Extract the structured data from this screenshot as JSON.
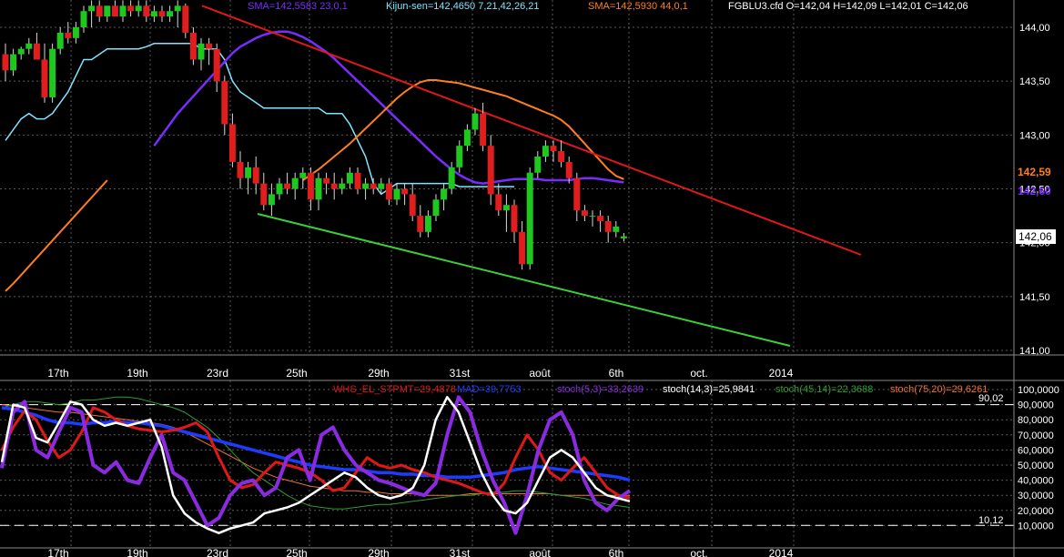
{
  "colors": {
    "background": "#000000",
    "grid": "#5a5a5a",
    "axis_text": "#ffffff",
    "bull_candle": "#1ec81e",
    "bear_candle": "#e01e1e",
    "wick": "#d9d9d9",
    "kijun": "#7fe5ff",
    "sma_purple": "#7a2cff",
    "sma_orange": "#ff7f1e",
    "resistance": "#e01818",
    "support": "#3ad03a",
    "whs": "#e01818",
    "stoch_blue": "#1e3cff",
    "stoch_white": "#ffffff",
    "stoch_green": "#2f9e2f",
    "stoch_orange": "#f0703a",
    "stoch_purple": "#8a2be2"
  },
  "header": {
    "sma1": "SMA=142,5583  23,0,1",
    "kijun": "Kijun-sen=142,4650  7,21,42,26,21",
    "sma2": "SMA=142,5930  44,0,1",
    "ohlc": "FGBLU3.cfd O=142,04 H=142,09 L=142,01 C=142,06"
  },
  "price_badges": {
    "sma_orange": "142,59",
    "sma_purple": "142,60",
    "last": "142,06"
  },
  "x_labels": [
    "17th",
    "19th",
    "23rd",
    "25th",
    "29th",
    "31st",
    "août",
    "6th",
    "oct.",
    "2014"
  ],
  "y_labels_price": [
    "144,00",
    "143,50",
    "143,00",
    "142,50",
    "142,00",
    "141,50",
    "141,00"
  ],
  "osc_header": {
    "whs": "WHS_EL_STPMT=29,4878",
    "mad": "MAD=39,7753",
    "s1": "stoch(5,3)=33,2639",
    "s2": "stoch(14,3)=25,9841",
    "s3": "stoch(45,14)=22,3688",
    "s4": "stoch(75,20)=29,6261"
  },
  "osc_levels": {
    "upper": "90,02",
    "lower": "10,12"
  },
  "y_labels_osc": [
    "100,0000",
    "90,0000",
    "80,0000",
    "70,0000",
    "60,0000",
    "50,0000",
    "40,0000",
    "30,0000",
    "20,0000",
    "10,0000"
  ],
  "chart_data": {
    "type": "candlestick",
    "symbol": "FGBLU3.cfd",
    "price_ylim": [
      141.0,
      144.2
    ],
    "candles": [
      [
        143.75,
        143.85,
        143.5,
        143.6
      ],
      [
        143.6,
        143.8,
        143.55,
        143.75
      ],
      [
        143.75,
        143.82,
        143.7,
        143.8
      ],
      [
        143.8,
        143.9,
        143.75,
        143.85
      ],
      [
        143.85,
        143.95,
        143.75,
        143.7
      ],
      [
        143.7,
        143.85,
        143.3,
        143.35
      ],
      [
        143.35,
        143.85,
        143.3,
        143.8
      ],
      [
        143.8,
        144.0,
        143.75,
        143.95
      ],
      [
        143.95,
        144.05,
        143.85,
        143.9
      ],
      [
        143.9,
        144.05,
        143.85,
        144.0
      ],
      [
        144.0,
        144.2,
        143.95,
        144.15
      ],
      [
        144.15,
        144.25,
        144.0,
        144.2
      ],
      [
        144.2,
        144.25,
        144.05,
        144.1
      ],
      [
        144.1,
        144.2,
        144.05,
        144.2
      ],
      [
        144.2,
        144.25,
        144.1,
        144.1
      ],
      [
        144.1,
        144.25,
        144.05,
        144.2
      ],
      [
        144.2,
        144.25,
        144.1,
        144.15
      ],
      [
        144.15,
        144.25,
        144.1,
        144.2
      ],
      [
        144.2,
        144.25,
        144.05,
        144.1
      ],
      [
        144.1,
        144.2,
        144.05,
        144.15
      ],
      [
        144.15,
        144.2,
        144.05,
        144.1
      ],
      [
        144.1,
        144.2,
        144.05,
        144.15
      ],
      [
        144.15,
        144.25,
        144.0,
        144.2
      ],
      [
        144.2,
        144.22,
        143.9,
        143.95
      ],
      [
        143.95,
        144.0,
        143.65,
        143.7
      ],
      [
        143.7,
        143.9,
        143.6,
        143.85
      ],
      [
        143.85,
        143.9,
        143.65,
        143.8
      ],
      [
        143.8,
        143.85,
        143.4,
        143.5
      ],
      [
        143.5,
        143.55,
        143.0,
        143.1
      ],
      [
        143.1,
        143.2,
        142.7,
        142.75
      ],
      [
        142.75,
        142.85,
        142.5,
        142.6
      ],
      [
        142.6,
        142.75,
        142.45,
        142.7
      ],
      [
        142.7,
        142.8,
        142.45,
        142.55
      ],
      [
        142.55,
        142.65,
        142.3,
        142.35
      ],
      [
        142.35,
        142.55,
        142.25,
        142.45
      ],
      [
        142.45,
        142.6,
        142.4,
        142.55
      ],
      [
        142.55,
        142.65,
        142.45,
        142.5
      ],
      [
        142.5,
        142.65,
        142.4,
        142.6
      ],
      [
        142.6,
        142.7,
        142.5,
        142.65
      ],
      [
        142.65,
        142.7,
        142.3,
        142.4
      ],
      [
        142.4,
        142.65,
        142.3,
        142.6
      ],
      [
        142.6,
        142.65,
        142.45,
        142.55
      ],
      [
        142.55,
        142.65,
        142.4,
        142.5
      ],
      [
        142.5,
        142.6,
        142.45,
        142.55
      ],
      [
        142.55,
        142.7,
        142.5,
        142.65
      ],
      [
        142.65,
        142.7,
        142.45,
        142.5
      ],
      [
        142.5,
        142.6,
        142.4,
        142.55
      ],
      [
        142.55,
        142.6,
        142.45,
        142.5
      ],
      [
        142.5,
        142.6,
        142.45,
        142.55
      ],
      [
        142.55,
        142.6,
        142.35,
        142.4
      ],
      [
        142.4,
        142.55,
        142.35,
        142.5
      ],
      [
        142.5,
        142.55,
        142.35,
        142.45
      ],
      [
        142.45,
        142.55,
        142.2,
        142.25
      ],
      [
        142.25,
        142.35,
        142.05,
        142.1
      ],
      [
        142.1,
        142.3,
        142.05,
        142.25
      ],
      [
        142.25,
        142.45,
        142.2,
        142.4
      ],
      [
        142.4,
        142.55,
        142.3,
        142.5
      ],
      [
        142.5,
        142.75,
        142.45,
        142.7
      ],
      [
        142.7,
        142.95,
        142.65,
        142.9
      ],
      [
        142.9,
        143.1,
        142.85,
        143.05
      ],
      [
        143.05,
        143.25,
        143.0,
        143.2
      ],
      [
        143.2,
        143.3,
        142.85,
        142.9
      ],
      [
        142.9,
        143.0,
        142.35,
        142.45
      ],
      [
        142.45,
        142.55,
        142.25,
        142.3
      ],
      [
        142.3,
        142.45,
        142.1,
        142.35
      ],
      [
        142.35,
        142.4,
        142.0,
        142.1
      ],
      [
        142.1,
        142.2,
        141.75,
        141.8
      ],
      [
        141.8,
        142.7,
        141.75,
        142.65
      ],
      [
        142.65,
        142.85,
        142.6,
        142.8
      ],
      [
        142.8,
        142.95,
        142.75,
        142.9
      ],
      [
        142.9,
        142.95,
        142.75,
        142.85
      ],
      [
        142.85,
        142.95,
        142.7,
        142.75
      ],
      [
        142.75,
        142.8,
        142.55,
        142.6
      ],
      [
        142.6,
        142.65,
        142.2,
        142.3
      ],
      [
        142.3,
        142.35,
        142.2,
        142.25
      ],
      [
        142.25,
        142.3,
        142.15,
        142.25
      ],
      [
        142.25,
        142.3,
        142.1,
        142.2
      ],
      [
        142.2,
        142.25,
        142.0,
        142.1
      ],
      [
        142.1,
        142.2,
        142.05,
        142.15
      ],
      [
        142.04,
        142.09,
        142.01,
        142.06
      ]
    ],
    "kijun_sen": [
      142.95,
      143.05,
      143.15,
      143.2,
      143.15,
      143.15,
      143.2,
      143.3,
      143.4,
      143.55,
      143.7,
      143.7,
      143.75,
      143.8,
      143.8,
      143.8,
      143.8,
      143.8,
      143.82,
      143.85,
      143.85,
      143.85,
      143.85,
      143.85,
      143.85,
      143.8,
      143.8,
      143.8,
      143.7,
      143.5,
      143.4,
      143.35,
      143.3,
      143.25,
      143.25,
      143.25,
      143.25,
      143.25,
      143.25,
      143.25,
      143.25,
      143.2,
      143.2,
      143.2,
      143.1,
      142.95,
      142.8,
      142.55,
      142.45,
      142.5,
      142.55,
      142.55,
      142.55,
      142.55,
      142.55,
      142.55,
      142.55,
      142.55,
      142.52,
      142.52,
      142.52,
      142.52,
      142.52,
      142.52,
      142.52,
      142.52
    ],
    "sma_23": [
      142.9,
      143.0,
      143.1,
      143.2,
      143.28,
      143.36,
      143.44,
      143.52,
      143.6,
      143.68,
      143.76,
      143.82,
      143.86,
      143.9,
      143.93,
      143.95,
      143.96,
      143.96,
      143.94,
      143.91,
      143.87,
      143.82,
      143.77,
      143.71,
      143.64,
      143.57,
      143.5,
      143.43,
      143.36,
      143.29,
      143.22,
      143.15,
      143.08,
      143.01,
      142.94,
      142.87,
      142.8,
      142.74,
      142.68,
      142.63,
      142.59,
      142.56,
      142.55,
      142.56,
      142.57,
      142.58,
      142.59,
      142.59,
      142.59,
      142.59,
      142.58,
      142.58,
      142.58,
      142.58,
      142.59,
      142.6,
      142.6,
      142.59,
      142.58,
      142.57,
      142.56
    ],
    "sma_44": [
      142.58,
      142.63,
      142.68,
      142.74,
      142.8,
      142.86,
      142.92,
      142.99,
      143.06,
      143.13,
      143.2,
      143.27,
      143.34,
      143.4,
      143.45,
      143.49,
      143.51,
      143.51,
      143.5,
      143.49,
      143.48,
      143.46,
      143.44,
      143.42,
      143.4,
      143.38,
      143.36,
      143.33,
      143.3,
      143.27,
      143.24,
      143.21,
      143.18,
      143.14,
      143.08,
      143.0,
      142.92,
      142.84,
      142.76,
      142.68,
      142.62,
      142.59
    ],
    "resistance_line": {
      "from": [
        "2013-07-22",
        144.2
      ],
      "to": [
        "oct.",
        141.9
      ]
    },
    "support_line": {
      "from": [
        "2013-07-24",
        142.25
      ],
      "to": [
        "oct.",
        141.05
      ]
    },
    "oscillators": {
      "ylim": [
        0,
        100
      ],
      "upper_level": 90.02,
      "lower_level": 10.12,
      "whs_el_stpmt": [
        60,
        75,
        86,
        80,
        66,
        55,
        60,
        72,
        88,
        85,
        80,
        76,
        74,
        73,
        72,
        73,
        75,
        78,
        72,
        55,
        40,
        35,
        37,
        45,
        52,
        50,
        48,
        45,
        40,
        33,
        35,
        45,
        55,
        50,
        48,
        50,
        47,
        45,
        42,
        40,
        38,
        35,
        32,
        30,
        38,
        55,
        70,
        60,
        45,
        40,
        48,
        55,
        45,
        35,
        30,
        28
      ],
      "mad": [
        88,
        87,
        85,
        83,
        80,
        78,
        78,
        77,
        78,
        78,
        79,
        78,
        78,
        77,
        76,
        74,
        72,
        70,
        68,
        66,
        64,
        62,
        60,
        58,
        56,
        54,
        52,
        50,
        49,
        48,
        47,
        47,
        46,
        45,
        45,
        44,
        44,
        43,
        43,
        42,
        42,
        42,
        43,
        44,
        45,
        47,
        48,
        49,
        48,
        47,
        46,
        45,
        44,
        43,
        42,
        40
      ],
      "stoch_5_3": [
        48,
        85,
        92,
        60,
        55,
        72,
        88,
        85,
        50,
        45,
        52,
        40,
        38,
        55,
        70,
        45,
        40,
        25,
        10,
        15,
        30,
        38,
        40,
        30,
        35,
        55,
        60,
        40,
        70,
        75,
        60,
        50,
        45,
        40,
        38,
        35,
        32,
        30,
        38,
        70,
        95,
        85,
        60,
        40,
        25,
        5,
        30,
        60,
        80,
        85,
        70,
        40,
        25,
        20,
        28,
        33
      ],
      "stoch_14_3": [
        52,
        90,
        88,
        68,
        65,
        78,
        92,
        90,
        80,
        76,
        78,
        76,
        78,
        80,
        62,
        30,
        18,
        12,
        8,
        5,
        8,
        10,
        12,
        18,
        20,
        22,
        25,
        30,
        35,
        40,
        45,
        42,
        35,
        30,
        28,
        30,
        35,
        50,
        80,
        95,
        85,
        65,
        45,
        30,
        20,
        18,
        25,
        40,
        55,
        60,
        55,
        45,
        35,
        30,
        28,
        26
      ],
      "stoch_45_14": [
        88,
        90,
        92,
        92,
        91,
        90,
        91,
        93,
        93,
        94,
        95,
        95,
        94,
        92,
        90,
        88,
        85,
        80,
        75,
        68,
        60,
        52,
        45,
        40,
        35,
        30,
        26,
        23,
        22,
        21,
        21,
        22,
        23,
        24,
        24,
        25,
        26,
        27,
        28,
        29,
        30,
        30,
        31,
        32,
        32,
        33,
        33,
        32,
        31,
        30,
        29,
        28,
        26,
        24,
        23,
        22
      ],
      "stoch_75_20": [
        90,
        89,
        88,
        87,
        86,
        85,
        85,
        84,
        83,
        82,
        81,
        80,
        79,
        78,
        77,
        75,
        72,
        68,
        64,
        60,
        56,
        52,
        48,
        45,
        42,
        40,
        38,
        36,
        35,
        34,
        33,
        33,
        32,
        32,
        31,
        31,
        31,
        30,
        30,
        30,
        30,
        31,
        31,
        31,
        31,
        31,
        31,
        31,
        31,
        30,
        30,
        30,
        30,
        30,
        30,
        29.6
      ]
    }
  }
}
